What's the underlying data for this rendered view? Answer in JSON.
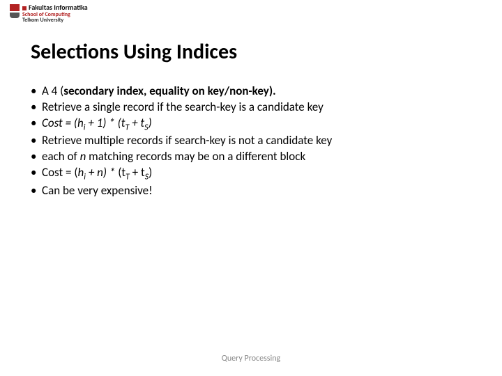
{
  "logo": {
    "line1": "Fakultas Informatika",
    "line2": "School of Computing",
    "line3": "Telkom University"
  },
  "title": "Selections Using Indices",
  "bullets": {
    "a4_label": "A 4 (",
    "a4_bold": "secondary index, equality on key/non-key).",
    "retrieve_single": "Retrieve a single record if the search-key is a candidate key",
    "cost1_prefix": "Cost = (h",
    "cost1_sub1": "i",
    "cost1_mid": " + 1) * (t",
    "cost1_sub2": "T",
    "cost1_mid2": " + t",
    "cost1_sub3": "S",
    "cost1_suffix": ")",
    "retrieve_multi": "Retrieve multiple records if search-key is not a candidate key",
    "each_of_n_prefix": "each of ",
    "each_of_n_ital": "n",
    "each_of_n_suffix": " matching records may be on a different block",
    "cost2_prefix": "Cost =  (",
    "cost2_hi_h": "h",
    "cost2_hi_i": "i",
    "cost2_plus_n": " + n) * ",
    "cost2_rest_prefix": "(t",
    "cost2_sub2": "T",
    "cost2_mid2": " + t",
    "cost2_sub3": "S",
    "cost2_suffix": ")",
    "expensive": "Can be very expensive!"
  },
  "footer": "Query Processing"
}
